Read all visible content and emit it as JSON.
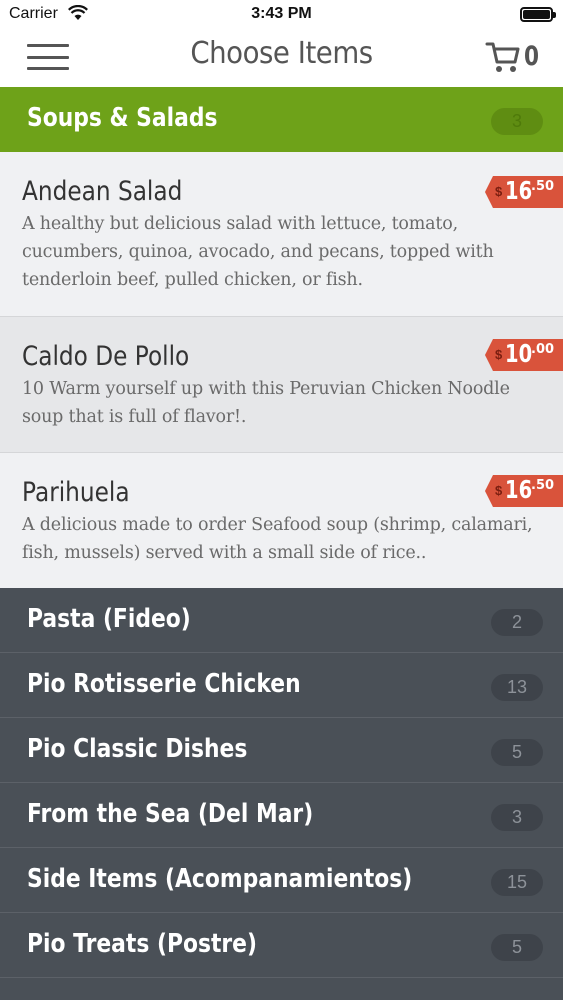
{
  "status_bar": {
    "carrier": "Carrier",
    "time": "3:43 PM"
  },
  "nav": {
    "title": "Choose Items",
    "cart_count": "0"
  },
  "expanded_category": {
    "name": "Soups & Salads",
    "count": "3",
    "color": "#6ea219"
  },
  "items": [
    {
      "name": "Andean Salad",
      "description": "A healthy but delicious salad with lettuce, tomato, cucumbers, quinoa, avocado, and pecans, topped with tenderloin beef, pulled chicken, or fish.",
      "currency": "$",
      "price_dollars": "16",
      "price_cents": ".50"
    },
    {
      "name": "Caldo De Pollo",
      "description": "10 Warm yourself up with this Peruvian Chicken Noodle soup that is full of flavor!.",
      "currency": "$",
      "price_dollars": "10",
      "price_cents": ".00"
    },
    {
      "name": "Parihuela",
      "description": "A delicious made to order Seafood soup (shrimp, calamari, fish, mussels) served with a small side of rice..",
      "currency": "$",
      "price_dollars": "16",
      "price_cents": ".50"
    }
  ],
  "categories": [
    {
      "name": "Pasta (Fideo)",
      "count": "2"
    },
    {
      "name": "Pio Rotisserie Chicken",
      "count": "13"
    },
    {
      "name": "Pio Classic Dishes",
      "count": "5"
    },
    {
      "name": "From the Sea (Del Mar)",
      "count": "3"
    },
    {
      "name": "Side Items (Acompanamientos)",
      "count": "15"
    },
    {
      "name": "Pio Treats (Postre)",
      "count": "5"
    }
  ],
  "colors": {
    "accent_green": "#6ea219",
    "price_red": "#d9533b",
    "dark_panel": "#4a5057"
  }
}
